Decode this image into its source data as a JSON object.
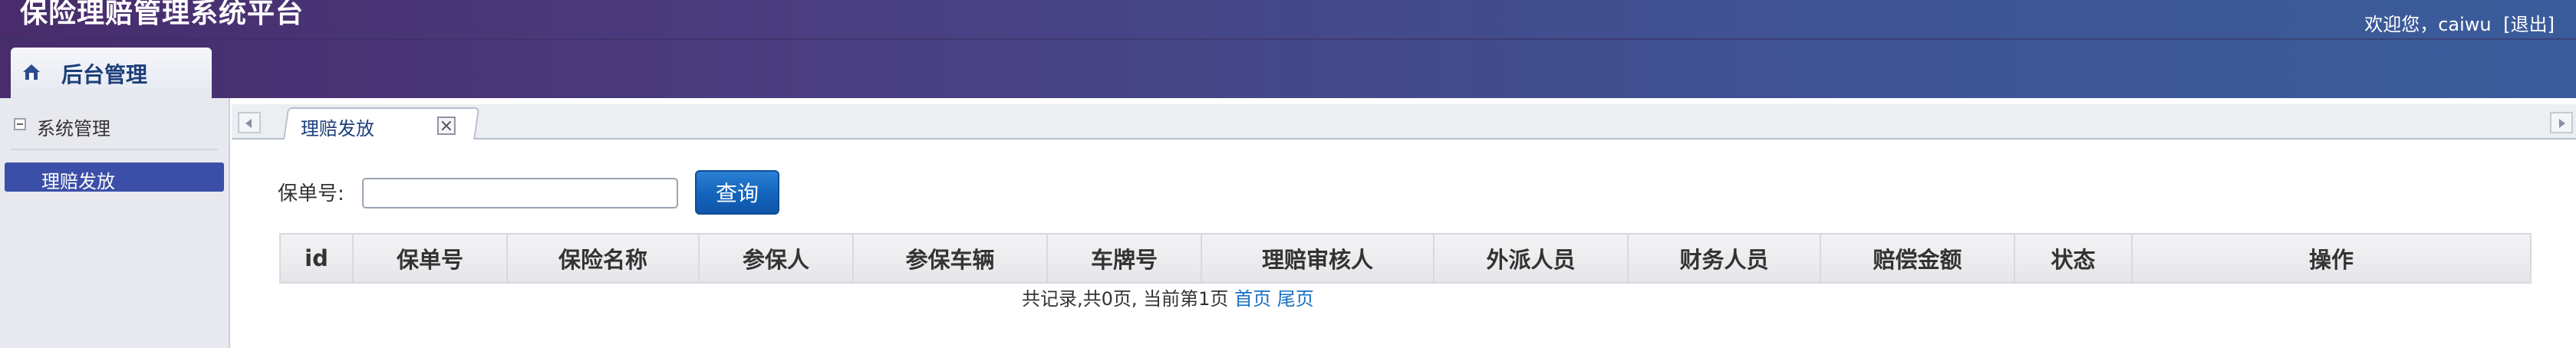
{
  "app": {
    "title": "保险理赔管理系统平台"
  },
  "user": {
    "greeting": "欢迎您，caiwu",
    "logout_label": "[退出]"
  },
  "module_tab": {
    "label": "后台管理",
    "icon": "home-icon"
  },
  "sidebar": {
    "group_label": "系统管理",
    "items": [
      {
        "label": "理赔发放",
        "active": true
      }
    ]
  },
  "tabs": [
    {
      "label": "理赔发放",
      "closable": true
    }
  ],
  "search": {
    "label": "保单号:",
    "value": "",
    "button_label": "查询"
  },
  "table": {
    "columns": [
      "id",
      "保单号",
      "保险名称",
      "参保人",
      "参保车辆",
      "车牌号",
      "理赔审核人",
      "外派人员",
      "财务人员",
      "赔偿金额",
      "状态",
      "操作"
    ],
    "rows": []
  },
  "pagination": {
    "summary": "共记录,共0页, 当前第1页",
    "first_label": "首页",
    "last_label": "尾页"
  },
  "colors": {
    "header_gradient_start": "#482c6c",
    "header_gradient_end": "#3a5c9a",
    "sidebar_active": "#3c4fa8",
    "button_blue": "#1464bd",
    "link_blue": "#1a6fc4"
  }
}
